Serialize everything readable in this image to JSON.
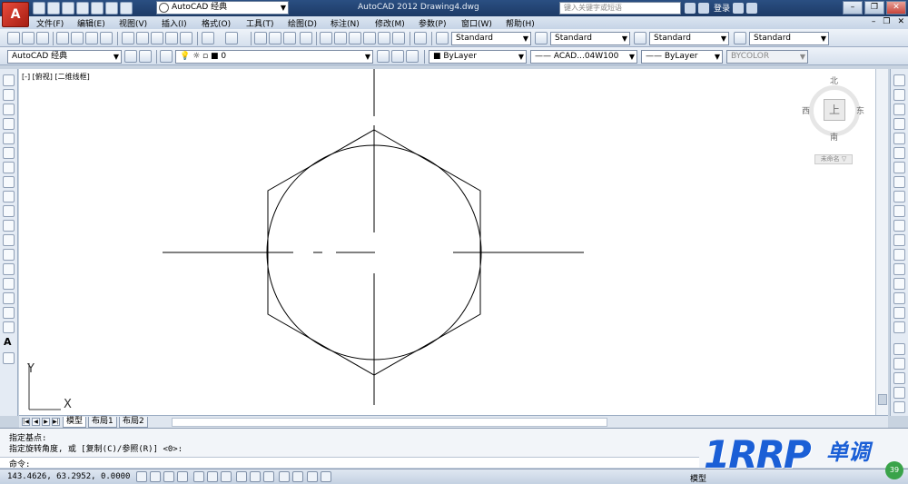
{
  "titlebar": {
    "workspace": "AutoCAD 经典",
    "title": "AutoCAD 2012    Drawing4.dwg",
    "search_placeholder": "键入关键字或短语",
    "login": "登录"
  },
  "menu": {
    "items": [
      "文件(F)",
      "编辑(E)",
      "视图(V)",
      "插入(I)",
      "格式(O)",
      "工具(T)",
      "绘图(D)",
      "标注(N)",
      "修改(M)",
      "参数(P)",
      "窗口(W)",
      "帮助(H)"
    ]
  },
  "toolbar1": {
    "text_style": "Standard",
    "dim_style": "Standard",
    "table_style": "Standard",
    "mleader_style": "Standard"
  },
  "toolbar2": {
    "workspace": "AutoCAD 经典",
    "layer": "0",
    "color": "ByLayer",
    "linetype": "—— ACAD...04W100",
    "lineweight": "—— ByLayer",
    "plotstyle": "BYCOLOR"
  },
  "viewport": {
    "label": "[-] [俯视] [二维线框]"
  },
  "viewcube": {
    "north": "北",
    "south": "南",
    "east": "东",
    "west": "西",
    "face": "上",
    "wcs": "未命名 ▽"
  },
  "ucs": {
    "x": "X",
    "y": "Y"
  },
  "tabs": [
    "模型",
    "布局1",
    "布局2"
  ],
  "command": {
    "line1": "指定基点:",
    "line2": "指定旋转角度, 或 [复制(C)/参照(R)] <0>:",
    "prompt": "命令:"
  },
  "status": {
    "coords": "143.4626, 63.2952, 0.0000",
    "model": "模型"
  },
  "watermark": {
    "main": "1RRP",
    "sub": "单调",
    "badge": "39"
  }
}
